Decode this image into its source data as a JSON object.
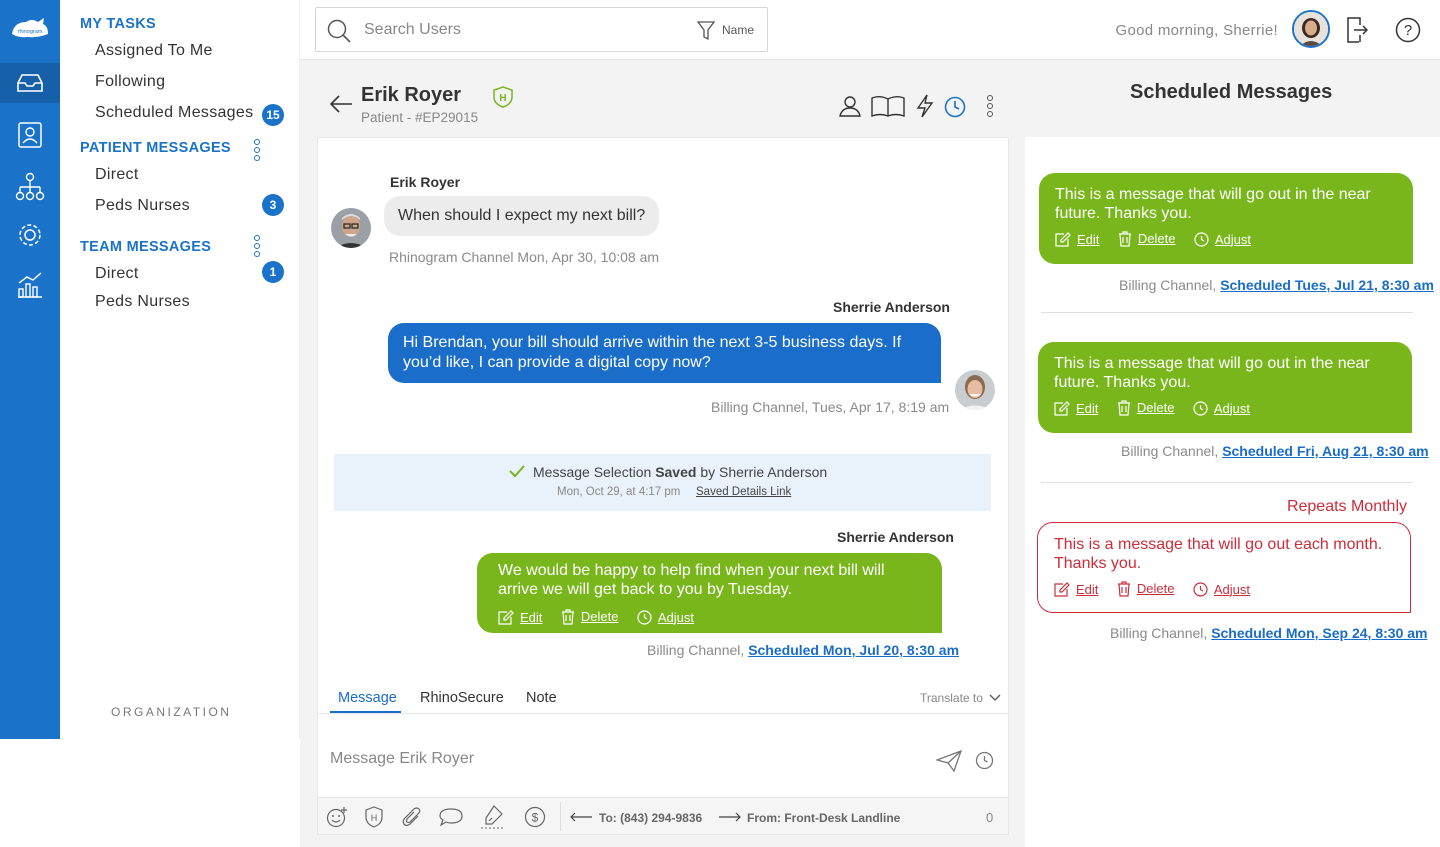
{
  "app": {
    "logo_text": "rhinogram"
  },
  "rail": {
    "icons": [
      "inbox-icon",
      "contacts-icon",
      "org-chart-icon",
      "settings-icon",
      "analytics-icon"
    ]
  },
  "menu": {
    "my_tasks": "MY TASKS",
    "assigned": "Assigned To Me",
    "following": "Following",
    "scheduled": "Scheduled Messages",
    "scheduled_count": "15",
    "patient_messages": "PATIENT MESSAGES",
    "pm_direct": "Direct",
    "pm_peds": "Peds Nurses",
    "pm_peds_count": "3",
    "team_messages": "TEAM MESSAGES",
    "tm_direct": "Direct",
    "tm_direct_count": "1",
    "tm_peds": "Peds Nurses",
    "organization": "ORGANIZATION"
  },
  "topbar": {
    "search_placeholder": "Search Users",
    "filter_label": "Name",
    "greeting": "Good morning, Sherrie!"
  },
  "convo": {
    "name": "Erik Royer",
    "subtitle": "Patient - #EP29015",
    "messages": [
      {
        "sender": "Erik Royer",
        "text": "When should I expect my next bill?",
        "meta": "Rhinogram Channel Mon, Apr 30, 10:08 am"
      },
      {
        "sender": "Sherrie Anderson",
        "text": "Hi Brendan, your bill should arrive within the next 3-5 business days. If you’d like, I can provide a digital copy now?",
        "meta": "Billing Channel, Tues, Apr 17, 8:19 am"
      },
      {
        "sender": "Sherrie Anderson",
        "text": "We would be happy to help find when your next bill will arrive we will get back to you by Tuesday.",
        "meta_prefix": "Billing Channel,",
        "meta_link": "Scheduled Mon, Jul 20, 8:30 am"
      }
    ],
    "event": {
      "text_prefix": "Message Selection",
      "text_bold": "Saved",
      "text_suffix": "by Sherrie Anderson",
      "time": "Mon, Oct 29, at 4:17 pm",
      "link": "Saved Details Link"
    },
    "actions": {
      "edit": "Edit",
      "delete": "Delete",
      "adjust": "Adjust"
    },
    "tabs": [
      "Message",
      "RhinoSecure",
      "Note"
    ],
    "translate": "Translate to",
    "compose_placeholder": "Message Erik Royer",
    "to": "To: (843) 294-9836",
    "from": "From: Front-Desk Landline",
    "char_count": "0"
  },
  "scheduled": {
    "title": "Scheduled Messages",
    "items": [
      {
        "text": "This is a message that will go out in the near future. Thanks you.",
        "meta_prefix": "Billing Channel,",
        "meta_link": "Scheduled Tues, Jul 21, 8:30 am"
      },
      {
        "text": "This is a message that will go out in the near future. Thanks you.",
        "meta_prefix": "Billing Channel,",
        "meta_link": "Scheduled Fri, Aug 21, 8:30 am"
      },
      {
        "repeat": "Repeats Monthly",
        "text": "This is a message that will go out each month. Thanks you.",
        "meta_prefix": "Billing Channel,",
        "meta_link": "Scheduled Mon, Sep 24, 8:30 am"
      }
    ]
  },
  "colors": {
    "brand_blue": "#1a73c8",
    "green": "#78b61c",
    "red": "#cc2d3a"
  }
}
